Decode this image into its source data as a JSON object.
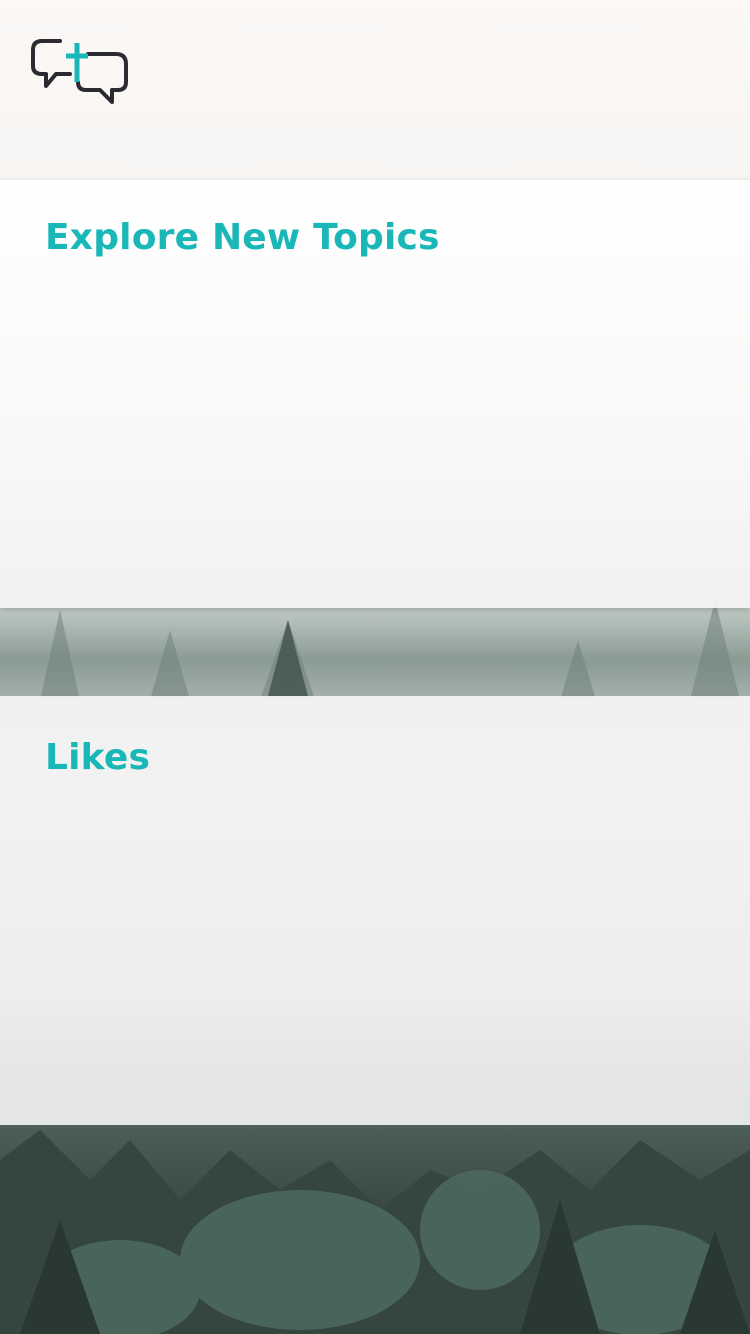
{
  "header": {
    "logo_icon": "speech-bubbles-cross-icon",
    "logo_stroke_color": "#2b2a30",
    "logo_accent_color": "#19b7b7"
  },
  "sections": [
    {
      "title": "Explore New Topics"
    },
    {
      "title": "Likes"
    }
  ],
  "theme": {
    "accent": "#19b7b7",
    "background": "foggy-forest-photo"
  }
}
